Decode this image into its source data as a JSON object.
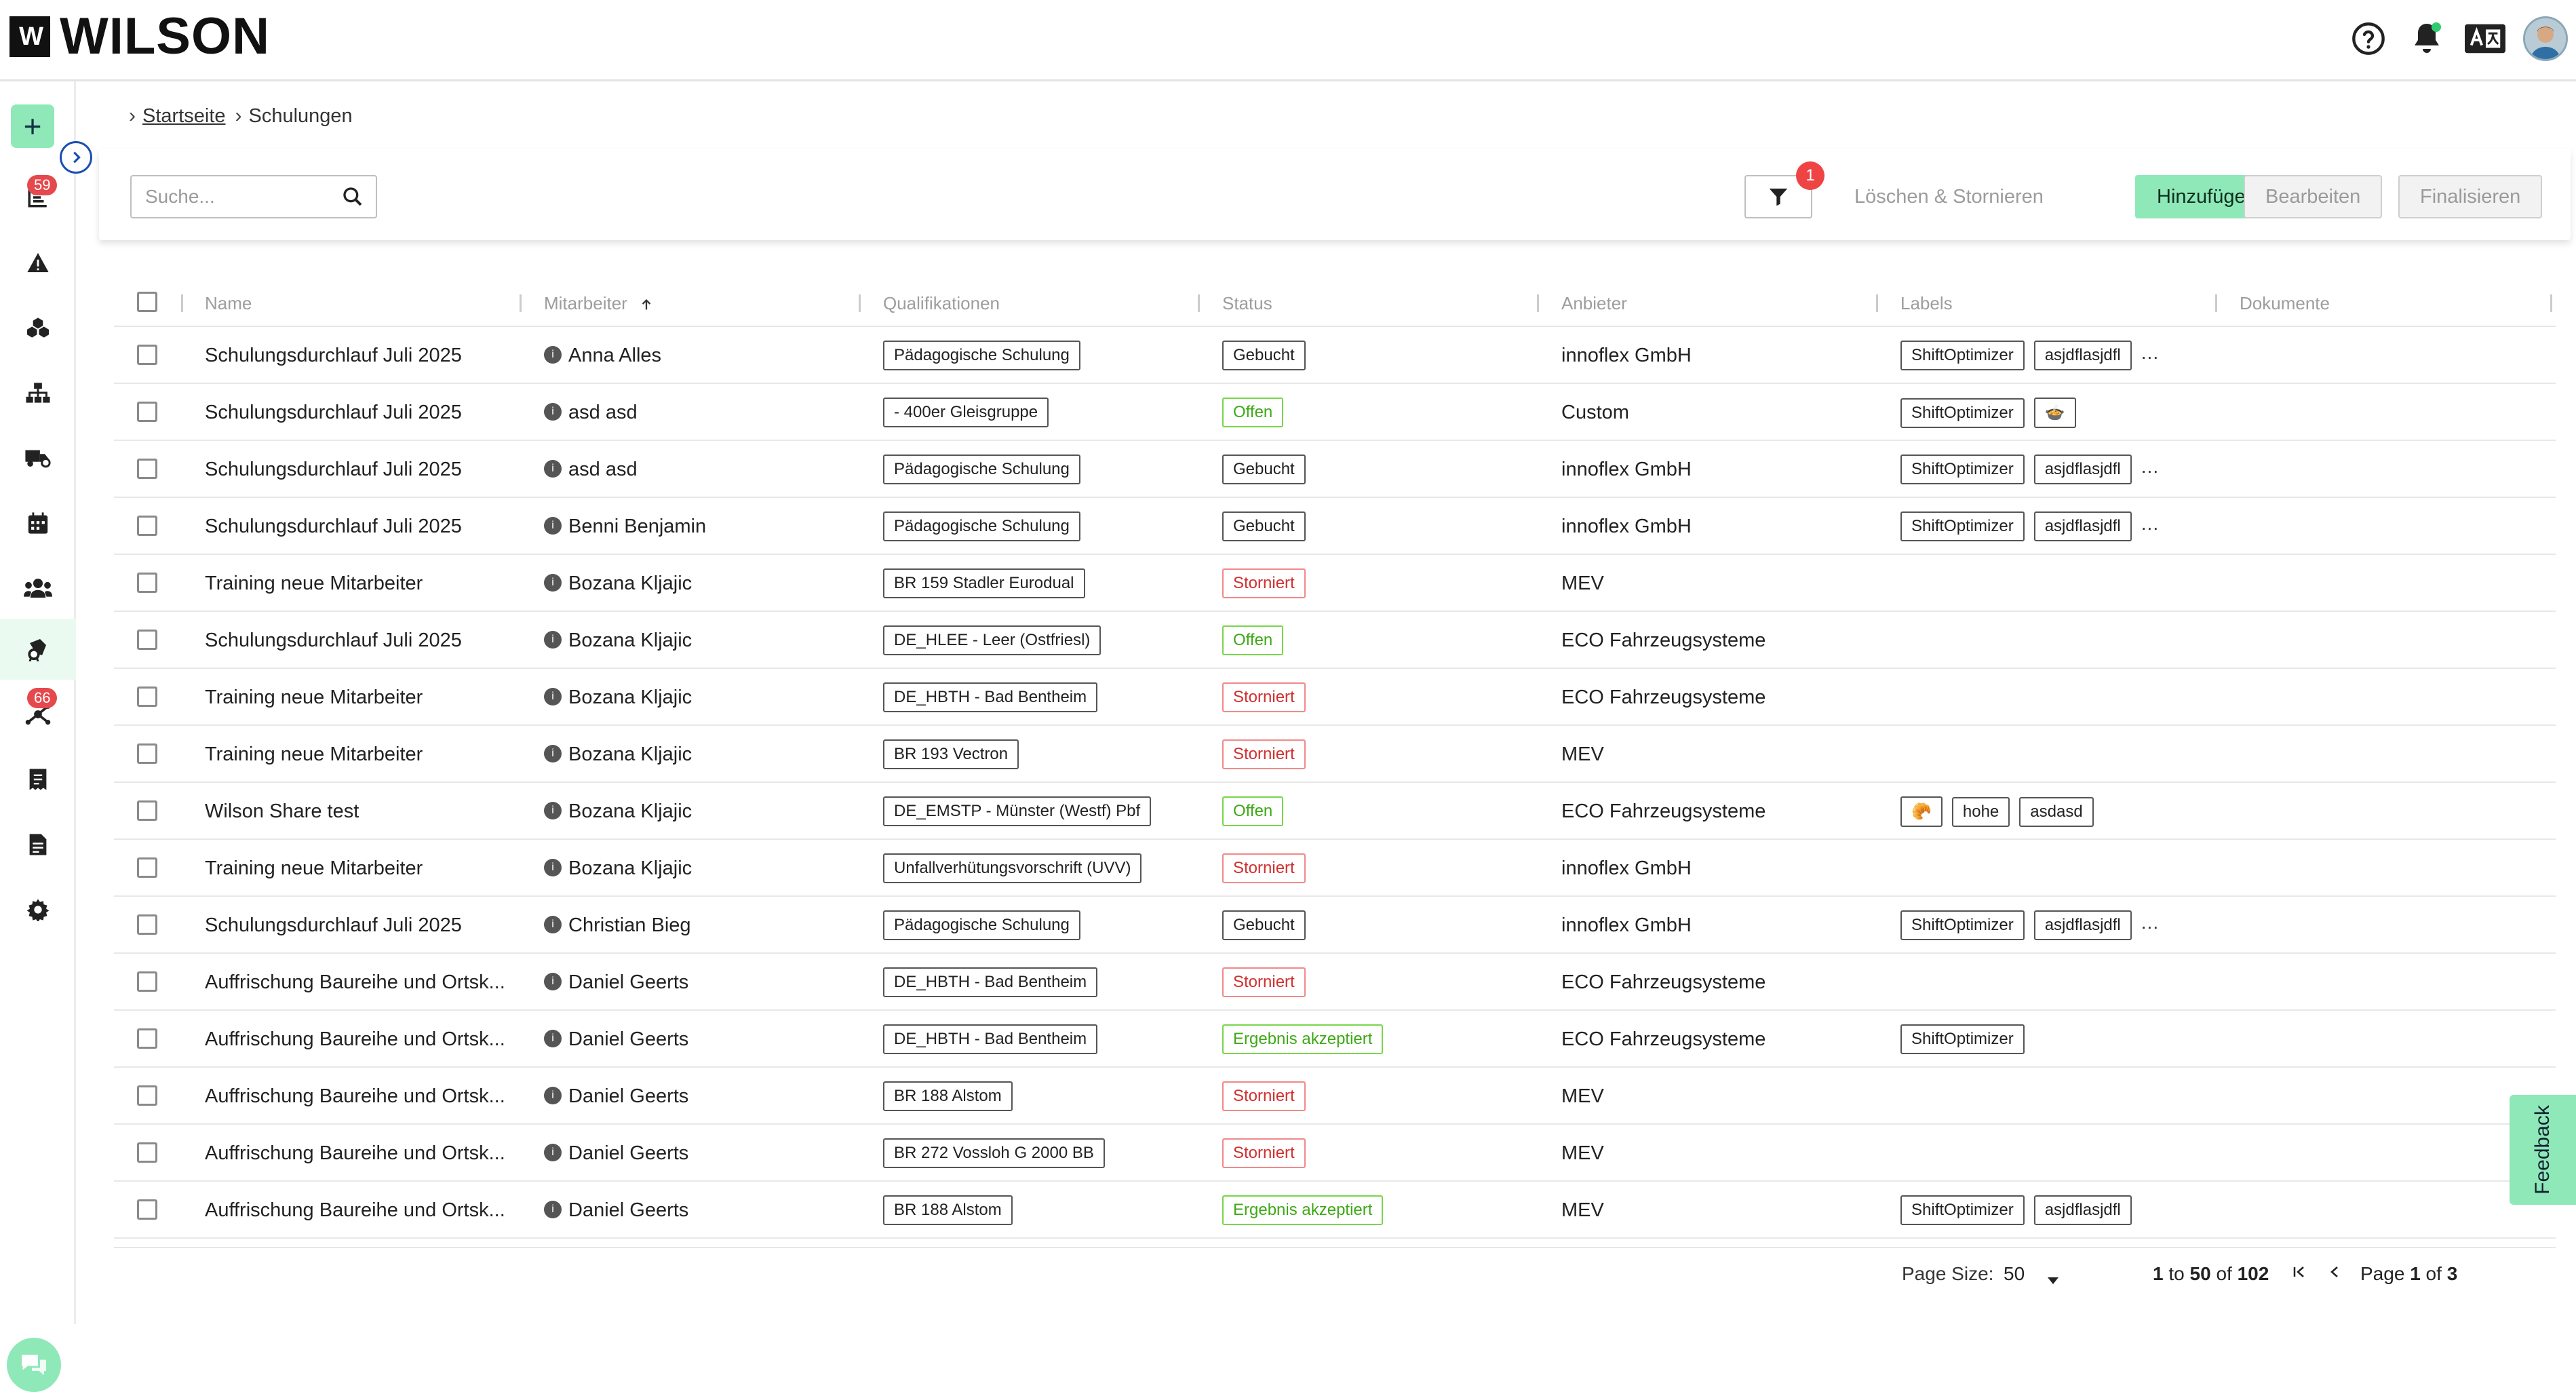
{
  "app": {
    "brand": "WILSON",
    "brand_mark": "W"
  },
  "sidebar": {
    "badges": {
      "list": "59",
      "network": "66"
    },
    "items": [
      {
        "name": "list-icon"
      },
      {
        "name": "warning-icon"
      },
      {
        "name": "boxes-icon"
      },
      {
        "name": "sitemap-icon"
      },
      {
        "name": "truck-icon"
      },
      {
        "name": "calendar-icon"
      },
      {
        "name": "users-icon"
      },
      {
        "name": "certificate-icon"
      },
      {
        "name": "network-icon"
      },
      {
        "name": "receipt-icon"
      },
      {
        "name": "document-icon"
      },
      {
        "name": "settings-icon"
      }
    ]
  },
  "breadcrumb": {
    "home": "Startseite",
    "current": "Schulungen"
  },
  "toolbar": {
    "search_placeholder": "Suche...",
    "filter_count": "1",
    "delete_cancel": "Löschen & Stornieren",
    "add": "Hinzufügen",
    "edit": "Bearbeiten",
    "finalize": "Finalisieren"
  },
  "table": {
    "headers": [
      "Name",
      "Mitarbeiter",
      "Qualifikationen",
      "Status",
      "Anbieter",
      "Labels",
      "Dokumente"
    ],
    "rows": [
      {
        "name": "Schulungsdurchlauf Juli 2025",
        "employee": "Anna Alles",
        "qual": "Pädagogische Schulung",
        "status": "Gebucht",
        "status_type": "booked",
        "provider": "innoflex GmbH",
        "labels": [
          "ShiftOptimizer",
          "asjdflasjdfl"
        ],
        "more": "..."
      },
      {
        "name": "Schulungsdurchlauf Juli 2025",
        "employee": "asd asd",
        "qual": "- 400er Gleisgruppe",
        "status": "Offen",
        "status_type": "open",
        "provider": "Custom",
        "labels": [
          "ShiftOptimizer",
          "🍲"
        ],
        "more": ""
      },
      {
        "name": "Schulungsdurchlauf Juli 2025",
        "employee": "asd asd",
        "qual": "Pädagogische Schulung",
        "status": "Gebucht",
        "status_type": "booked",
        "provider": "innoflex GmbH",
        "labels": [
          "ShiftOptimizer",
          "asjdflasjdfl"
        ],
        "more": "..."
      },
      {
        "name": "Schulungsdurchlauf Juli 2025",
        "employee": "Benni Benjamin",
        "qual": "Pädagogische Schulung",
        "status": "Gebucht",
        "status_type": "booked",
        "provider": "innoflex GmbH",
        "labels": [
          "ShiftOptimizer",
          "asjdflasjdfl"
        ],
        "more": "..."
      },
      {
        "name": "Training neue Mitarbeiter",
        "employee": "Bozana Kljajic",
        "qual": "BR 159 Stadler Eurodual",
        "status": "Storniert",
        "status_type": "cancelled",
        "provider": "MEV",
        "labels": [],
        "more": ""
      },
      {
        "name": "Schulungsdurchlauf Juli 2025",
        "employee": "Bozana Kljajic",
        "qual": "DE_HLEE - Leer (Ostfriesl)",
        "status": "Offen",
        "status_type": "open",
        "provider": "ECO Fahrzeugsysteme",
        "labels": [],
        "more": ""
      },
      {
        "name": "Training neue Mitarbeiter",
        "employee": "Bozana Kljajic",
        "qual": "DE_HBTH - Bad Bentheim",
        "status": "Storniert",
        "status_type": "cancelled",
        "provider": "ECO Fahrzeugsysteme",
        "labels": [],
        "more": ""
      },
      {
        "name": "Training neue Mitarbeiter",
        "employee": "Bozana Kljajic",
        "qual": "BR 193 Vectron",
        "status": "Storniert",
        "status_type": "cancelled",
        "provider": "MEV",
        "labels": [],
        "more": ""
      },
      {
        "name": "Wilson Share test",
        "employee": "Bozana Kljajic",
        "qual": "DE_EMSTP - Münster (Westf) Pbf",
        "status": "Offen",
        "status_type": "open",
        "provider": "ECO Fahrzeugsysteme",
        "labels": [
          "🥐",
          "hohe",
          "asdasd"
        ],
        "more": ""
      },
      {
        "name": "Training neue Mitarbeiter",
        "employee": "Bozana Kljajic",
        "qual": "Unfallverhütungsvorschrift (UVV)",
        "status": "Storniert",
        "status_type": "cancelled",
        "provider": "innoflex GmbH",
        "labels": [],
        "more": ""
      },
      {
        "name": "Schulungsdurchlauf Juli 2025",
        "employee": "Christian Bieg",
        "qual": "Pädagogische Schulung",
        "status": "Gebucht",
        "status_type": "booked",
        "provider": "innoflex GmbH",
        "labels": [
          "ShiftOptimizer",
          "asjdflasjdfl"
        ],
        "more": "..."
      },
      {
        "name": "Auffrischung Baureihe und Ortsk...",
        "employee": "Daniel Geerts",
        "qual": "DE_HBTH - Bad Bentheim",
        "status": "Storniert",
        "status_type": "cancelled",
        "provider": "ECO Fahrzeugsysteme",
        "labels": [],
        "more": ""
      },
      {
        "name": "Auffrischung Baureihe und Ortsk...",
        "employee": "Daniel Geerts",
        "qual": "DE_HBTH - Bad Bentheim",
        "status": "Ergebnis akzeptiert",
        "status_type": "accepted",
        "provider": "ECO Fahrzeugsysteme",
        "labels": [
          "ShiftOptimizer"
        ],
        "more": ""
      },
      {
        "name": "Auffrischung Baureihe und Ortsk...",
        "employee": "Daniel Geerts",
        "qual": "BR 188 Alstom",
        "status": "Storniert",
        "status_type": "cancelled",
        "provider": "MEV",
        "labels": [],
        "more": ""
      },
      {
        "name": "Auffrischung Baureihe und Ortsk...",
        "employee": "Daniel Geerts",
        "qual": "BR 272 Vossloh G 2000 BB",
        "status": "Storniert",
        "status_type": "cancelled",
        "provider": "MEV",
        "labels": [],
        "more": ""
      },
      {
        "name": "Auffrischung Baureihe und Ortsk...",
        "employee": "Daniel Geerts",
        "qual": "BR 188 Alstom",
        "status": "Ergebnis akzeptiert",
        "status_type": "accepted",
        "provider": "MEV",
        "labels": [
          "ShiftOptimizer",
          "asjdflasjdfl"
        ],
        "more": ""
      }
    ]
  },
  "pager": {
    "page_size_label": "Page Size:",
    "page_size": "50",
    "range_from": "1",
    "range_to": "50",
    "range_total": "102",
    "range_to_word": "to",
    "range_of_word": "of",
    "page_word": "Page",
    "page_current": "1",
    "page_of_word": "of",
    "page_total": "3"
  },
  "feedback": "Feedback"
}
